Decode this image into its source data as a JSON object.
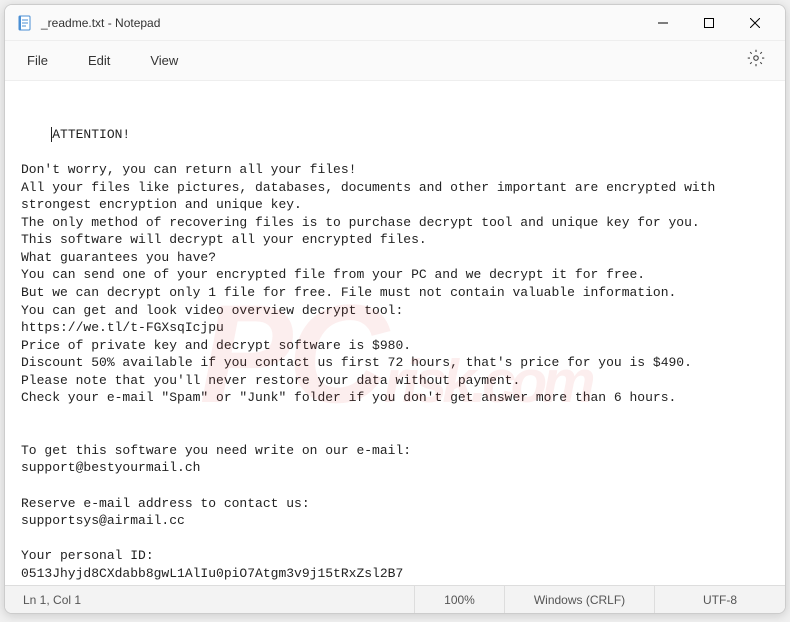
{
  "window": {
    "title": "_readme.txt - Notepad"
  },
  "menu": {
    "file": "File",
    "edit": "Edit",
    "view": "View"
  },
  "body": {
    "text": "ATTENTION!\n\nDon't worry, you can return all your files!\nAll your files like pictures, databases, documents and other important are encrypted with strongest encryption and unique key.\nThe only method of recovering files is to purchase decrypt tool and unique key for you.\nThis software will decrypt all your encrypted files.\nWhat guarantees you have?\nYou can send one of your encrypted file from your PC and we decrypt it for free.\nBut we can decrypt only 1 file for free. File must not contain valuable information.\nYou can get and look video overview decrypt tool:\nhttps://we.tl/t-FGXsqIcjpu\nPrice of private key and decrypt software is $980.\nDiscount 50% available if you contact us first 72 hours, that's price for you is $490.\nPlease note that you'll never restore your data without payment.\nCheck your e-mail \"Spam\" or \"Junk\" folder if you don't get answer more than 6 hours.\n\n\nTo get this software you need write on our e-mail:\nsupport@bestyourmail.ch\n\nReserve e-mail address to contact us:\nsupportsys@airmail.cc\n\nYour personal ID:\n0513Jhyjd8CXdabb8gwL1AlIu0piO7Atgm3v9j15tRxZsl2B7"
  },
  "status": {
    "position": "Ln 1, Col 1",
    "zoom": "100%",
    "line_ending": "Windows (CRLF)",
    "encoding": "UTF-8"
  }
}
